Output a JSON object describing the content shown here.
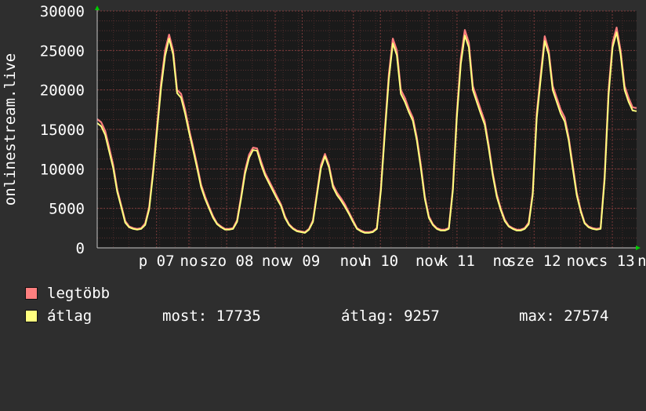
{
  "chart_data": {
    "type": "line",
    "ylabel": "onlinestream.live",
    "ylim": [
      0,
      30000
    ],
    "yticks": [
      0,
      5000,
      10000,
      15000,
      20000,
      25000,
      30000
    ],
    "grid": true,
    "xticks": [
      {
        "label": "p 07",
        "pos": 0.11
      },
      {
        "label": "no",
        "pos": 0.17
      },
      {
        "label": "szo 08",
        "pos": 0.24
      },
      {
        "label": "nov",
        "pos": 0.33
      },
      {
        "label": "v 09",
        "pos": 0.38
      },
      {
        "label": "nov",
        "pos": 0.475
      },
      {
        "label": "h 10",
        "pos": 0.525
      },
      {
        "label": "nov",
        "pos": 0.615
      },
      {
        "label": "k 11",
        "pos": 0.667
      },
      {
        "label": "no",
        "pos": 0.75
      },
      {
        "label": "sze 12",
        "pos": 0.81
      },
      {
        "label": "nov",
        "pos": 0.895
      },
      {
        "label": "cs 13",
        "pos": 0.955
      },
      {
        "label": "n",
        "pos": 1.01
      }
    ],
    "x": [
      0.0,
      0.005,
      0.01,
      0.015,
      0.02,
      0.03,
      0.04,
      0.05,
      0.06,
      0.07,
      0.08,
      0.09,
      0.095,
      0.1,
      0.105,
      0.11,
      0.115,
      0.12,
      0.125,
      0.13,
      0.135,
      0.14,
      0.15,
      0.16,
      0.17,
      0.18,
      0.19,
      0.2,
      0.21,
      0.22,
      0.23,
      0.24,
      0.25,
      0.26,
      0.27,
      0.28,
      0.29,
      0.3,
      0.31,
      0.32,
      0.33,
      0.34,
      0.35,
      0.36,
      0.37,
      0.38,
      0.39,
      0.4,
      0.41,
      0.42,
      0.43,
      0.44,
      0.45,
      0.46,
      0.47,
      0.48,
      0.49,
      0.5,
      0.51,
      0.52,
      0.53,
      0.54,
      0.55,
      0.56,
      0.57,
      0.58,
      0.59,
      0.6,
      0.61,
      0.62,
      0.63,
      0.64,
      0.65,
      0.66,
      0.67,
      0.68,
      0.69,
      0.7,
      0.71,
      0.72,
      0.73,
      0.74,
      0.75,
      0.76,
      0.77,
      0.78,
      0.79,
      0.8,
      0.81,
      0.82,
      0.83,
      0.84,
      0.85,
      0.86,
      0.87,
      0.88,
      0.89,
      0.9,
      0.91,
      0.92,
      0.93,
      0.94,
      0.95,
      0.96,
      0.965,
      0.97,
      0.975,
      0.98,
      0.99,
      1.0
    ],
    "series": [
      {
        "name": "legtöbb",
        "color": "#ff7f7f",
        "values": [
          16300,
          15900,
          14800,
          12700,
          10500,
          7400,
          5400,
          3400,
          2700,
          2500,
          2400,
          2500,
          3100,
          5200,
          9800,
          15500,
          21000,
          25000,
          27000,
          25000,
          20000,
          19500,
          17500,
          15000,
          12800,
          10500,
          8000,
          6500,
          5200,
          4000,
          3100,
          2700,
          2400,
          2400,
          2500,
          3500,
          6500,
          9800,
          11800,
          12700,
          12600,
          11000,
          9500,
          8500,
          7500,
          6500,
          5500,
          4000,
          3000,
          2500,
          2200,
          2100,
          2000,
          2400,
          3500,
          7000,
          10500,
          11900,
          10500,
          8000,
          7000,
          6300,
          5500,
          4500,
          3500,
          2500,
          2200,
          2000,
          2000,
          2100,
          2500,
          7500,
          15000,
          22000,
          26500,
          25000,
          20000,
          19000,
          17600,
          16500,
          14000,
          10500,
          6500,
          4000,
          3000,
          2500,
          2300,
          2300,
          2500,
          7500,
          17000,
          24000,
          27600,
          26000,
          20500,
          19000,
          17500,
          16000,
          13000,
          9500,
          6800,
          5000,
          3600,
          2800,
          2500,
          2300,
          2300,
          2500,
          3200,
          7000,
          17000,
          22000,
          26800,
          25000,
          20500,
          19000,
          17500,
          16500,
          14000,
          10500,
          7000,
          4800,
          3200,
          2700,
          2500,
          2400,
          2500,
          9000,
          20000,
          26000,
          27900,
          25000,
          20500,
          19000,
          17800,
          17700
        ]
      },
      {
        "name": "átlag",
        "color": "#ffff7f",
        "values": [
          15800,
          15400,
          14300,
          12200,
          10100,
          7100,
          5200,
          3200,
          2600,
          2400,
          2300,
          2400,
          2900,
          4900,
          9400,
          14900,
          20300,
          24300,
          26500,
          24500,
          19600,
          19000,
          17000,
          14600,
          12400,
          10100,
          7700,
          6200,
          5000,
          3800,
          3000,
          2600,
          2300,
          2300,
          2400,
          3300,
          6200,
          9400,
          11400,
          12400,
          12300,
          10600,
          9200,
          8200,
          7200,
          6200,
          5300,
          3800,
          2900,
          2400,
          2100,
          2000,
          1900,
          2300,
          3300,
          6700,
          10100,
          11600,
          10200,
          7700,
          6700,
          6000,
          5200,
          4300,
          3300,
          2400,
          2100,
          1900,
          1900,
          2000,
          2400,
          7200,
          14500,
          21400,
          25900,
          24400,
          19500,
          18500,
          17200,
          16100,
          13600,
          10100,
          6200,
          3800,
          2900,
          2400,
          2200,
          2200,
          2400,
          7200,
          16500,
          23300,
          26900,
          25400,
          20000,
          18500,
          17000,
          15600,
          12600,
          9200,
          6500,
          4800,
          3400,
          2700,
          2400,
          2200,
          2200,
          2400,
          3000,
          6700,
          16400,
          21400,
          26200,
          24500,
          20000,
          18500,
          17000,
          16000,
          13600,
          10100,
          6700,
          4600,
          3100,
          2600,
          2400,
          2300,
          2400,
          8600,
          19400,
          25400,
          27300,
          24500,
          20000,
          18500,
          17400,
          17300
        ]
      }
    ],
    "legend": {
      "placement": "bottom-left",
      "stats": {
        "most": "most: 17735",
        "atlag": "átlag: 9257",
        "max": "max: 27574"
      }
    }
  }
}
